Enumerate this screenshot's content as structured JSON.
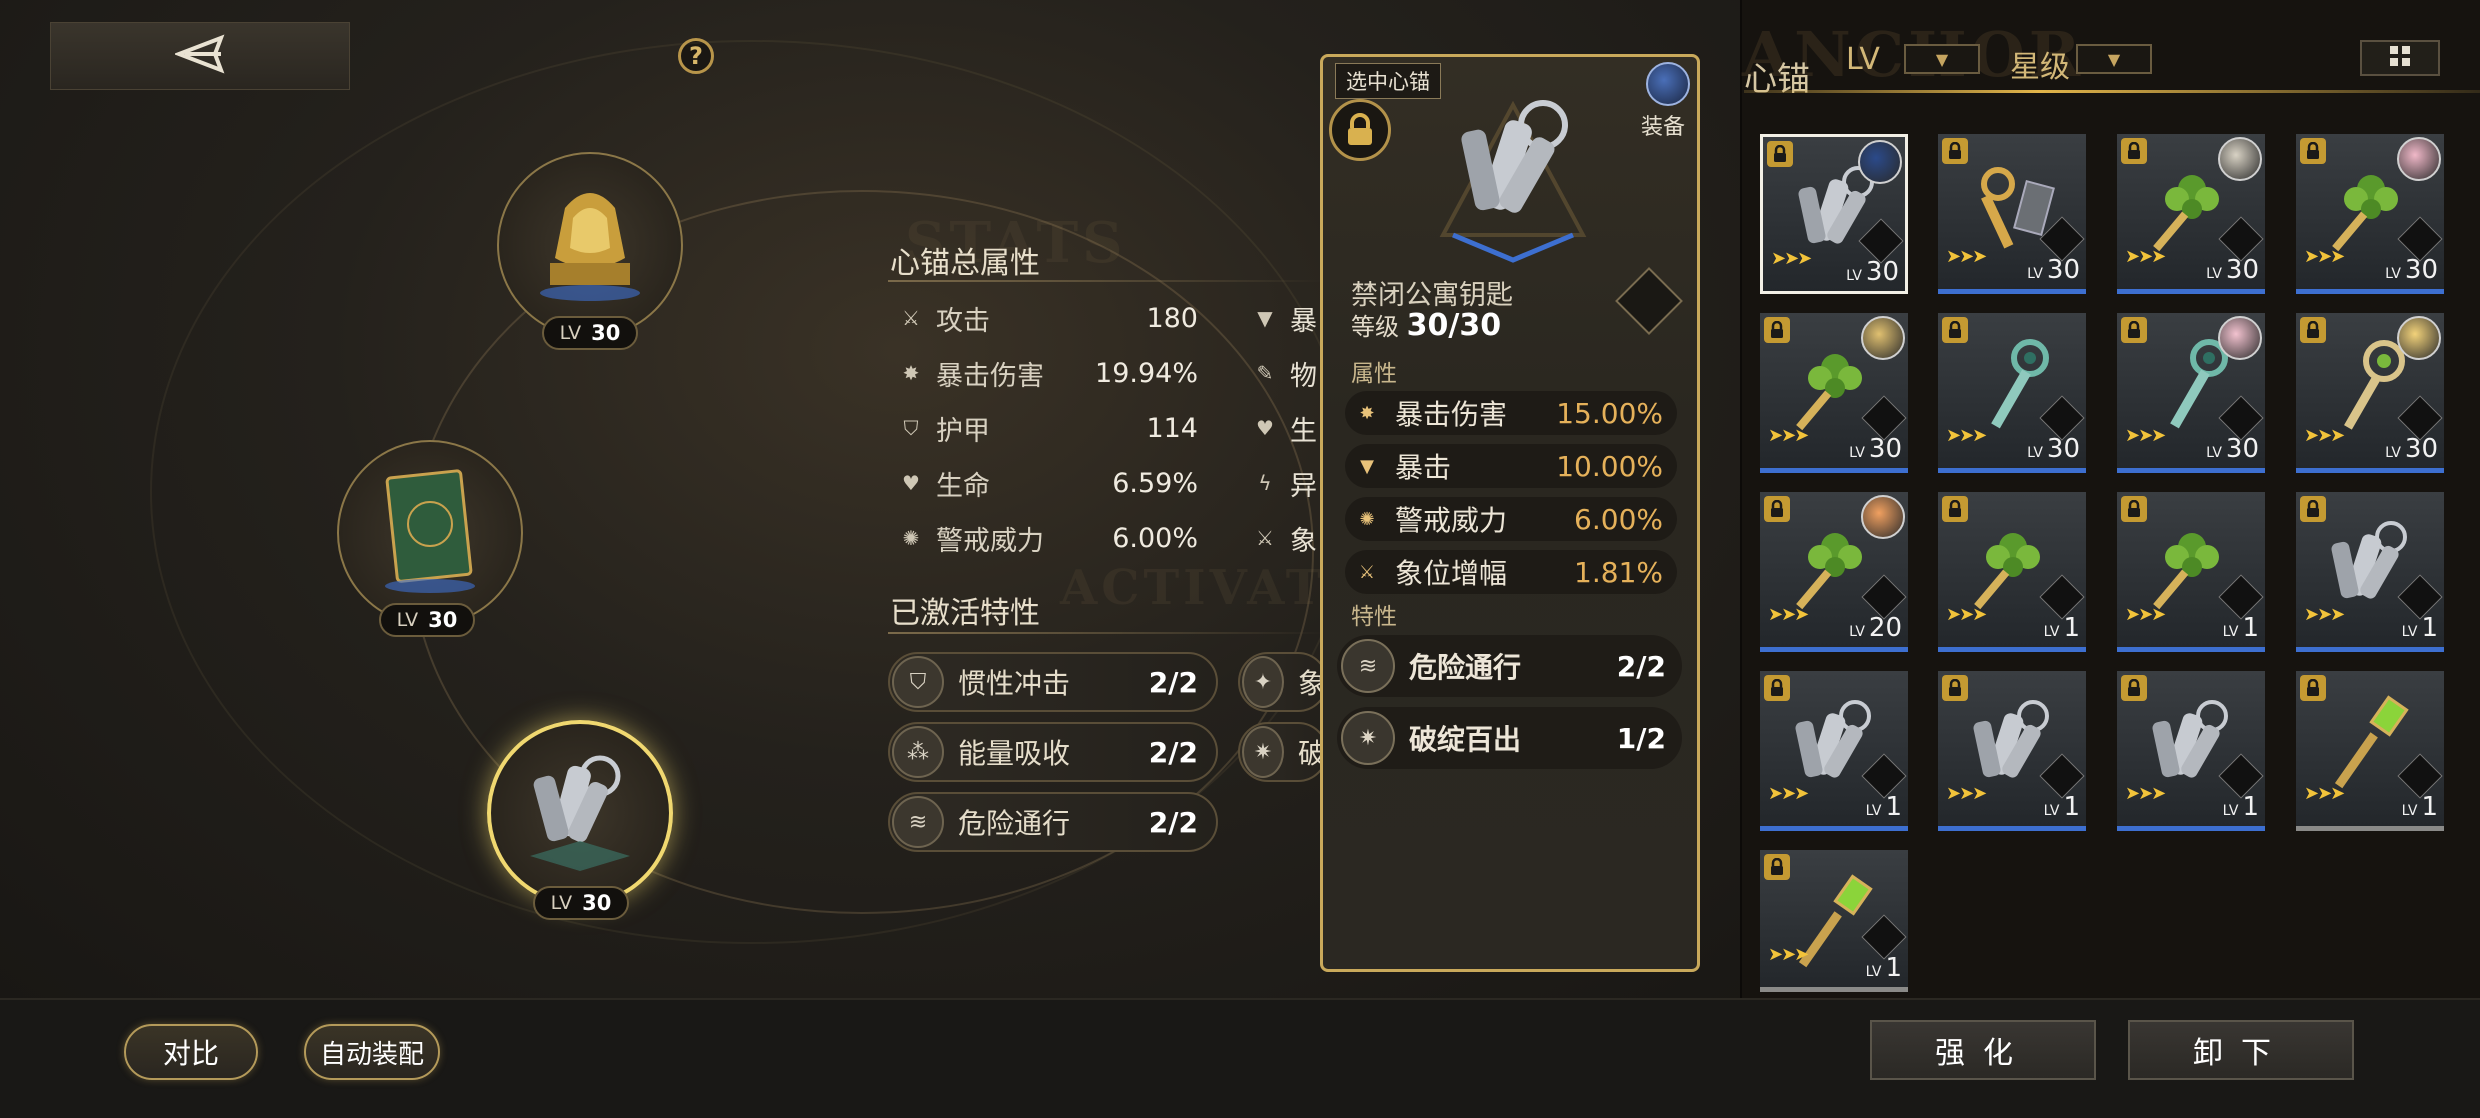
{
  "header": {
    "back_icon": "back-triangle-icon",
    "help_glyph": "?"
  },
  "watermarks": {
    "stats": "STATS",
    "activated": "ACTIVATED",
    "anchor": "ANCHOR"
  },
  "slots": [
    {
      "lv_label": "LV",
      "lv": "30",
      "icon": "golden-lion-statue"
    },
    {
      "lv_label": "LV",
      "lv": "30",
      "icon": "green-book"
    },
    {
      "lv_label": "LV",
      "lv": "30",
      "icon": "key-bundle",
      "selected": true
    }
  ],
  "stats": {
    "title": "心锚总属性",
    "rows": [
      {
        "icon": "sword-icon",
        "name": "攻击",
        "value": "180"
      },
      {
        "icon": "crit-damage-icon",
        "name": "暴击伤害",
        "value": "19.94%"
      },
      {
        "icon": "shield-icon",
        "name": "护甲",
        "value": "114"
      },
      {
        "icon": "heart-icon",
        "name": "生命",
        "value": "6.59%"
      },
      {
        "icon": "alert-icon",
        "name": "警戒威力",
        "value": "6.00%"
      }
    ],
    "col2": [
      {
        "icon": "crit-icon",
        "name": "暴"
      },
      {
        "icon": "physical-icon",
        "name": "物"
      },
      {
        "icon": "heart-icon",
        "name": "生"
      },
      {
        "icon": "anomaly-icon",
        "name": "异"
      },
      {
        "icon": "sword-icon",
        "name": "象"
      }
    ]
  },
  "traits": {
    "title": "已激活特性",
    "items": [
      {
        "name": "惯性冲击",
        "value": "2/2"
      },
      {
        "name": "能量吸收",
        "value": "2/2"
      },
      {
        "name": "危险通行",
        "value": "2/2"
      }
    ],
    "col2_partial": [
      {
        "name": "象"
      },
      {
        "name": "破"
      }
    ]
  },
  "detail": {
    "tag": "选中心锚",
    "equip_label": "装备",
    "name": "禁闭公寓钥匙",
    "level_label": "等级",
    "level": "30/30",
    "attr_section": "属性",
    "attrs": [
      {
        "name": "暴击伤害",
        "value": "15.00%"
      },
      {
        "name": "暴击",
        "value": "10.00%"
      },
      {
        "name": "警戒威力",
        "value": "6.00%"
      },
      {
        "name": "象位增幅",
        "value": "1.81%"
      }
    ],
    "trait_section": "特性",
    "traits": [
      {
        "name": "危险通行",
        "value": "2/2"
      },
      {
        "name": "破绽百出",
        "value": "1/2"
      }
    ]
  },
  "inventory": {
    "title": "心锚",
    "filter_lv": "LV",
    "filter_star": "星级",
    "cards": [
      {
        "lv": "30",
        "art": "silver-keys",
        "avatar": "#2b4a8a",
        "selected": true,
        "bar": "blue"
      },
      {
        "lv": "30",
        "art": "gold-key",
        "avatar": "",
        "bar": "blue"
      },
      {
        "lv": "30",
        "art": "clover-key",
        "avatar": "#d8d2c4",
        "bar": "blue"
      },
      {
        "lv": "30",
        "art": "clover-key",
        "avatar": "#f0b8c8",
        "bar": "blue"
      },
      {
        "lv": "30",
        "art": "clover-key",
        "avatar": "#e0c070",
        "bar": "blue"
      },
      {
        "lv": "30",
        "art": "teal-key",
        "avatar": "",
        "bar": "blue"
      },
      {
        "lv": "30",
        "art": "teal-key",
        "avatar": "#f2c2cf",
        "bar": "blue"
      },
      {
        "lv": "30",
        "art": "ornate-key",
        "avatar": "#f2d27a",
        "bar": "blue"
      },
      {
        "lv": "20",
        "art": "clover-key",
        "avatar": "#f0a060",
        "bar": "blue"
      },
      {
        "lv": "1",
        "art": "clover-key",
        "avatar": "",
        "bar": "blue"
      },
      {
        "lv": "1",
        "art": "clover-key",
        "avatar": "",
        "bar": "blue"
      },
      {
        "lv": "1",
        "art": "silver-keys",
        "avatar": "",
        "bar": "blue"
      },
      {
        "lv": "1",
        "art": "silver-keys",
        "avatar": "",
        "bar": "blue"
      },
      {
        "lv": "1",
        "art": "silver-keys",
        "avatar": "",
        "bar": "blue"
      },
      {
        "lv": "1",
        "art": "silver-keys",
        "avatar": "",
        "bar": "blue"
      },
      {
        "lv": "1",
        "art": "green-gem-key",
        "avatar": "",
        "bar": "gray"
      },
      {
        "lv": "1",
        "art": "green-gem-key",
        "avatar": "",
        "bar": "gray"
      }
    ],
    "card_lv_label": "LV"
  },
  "footer": {
    "compare": "对比",
    "auto_equip": "自动装配",
    "enhance": "强化",
    "unequip": "卸下"
  },
  "colors": {
    "accent_gold": "#d8b050",
    "value_orange": "#e5b15a",
    "rarity_blue": "#3d6fd0"
  }
}
